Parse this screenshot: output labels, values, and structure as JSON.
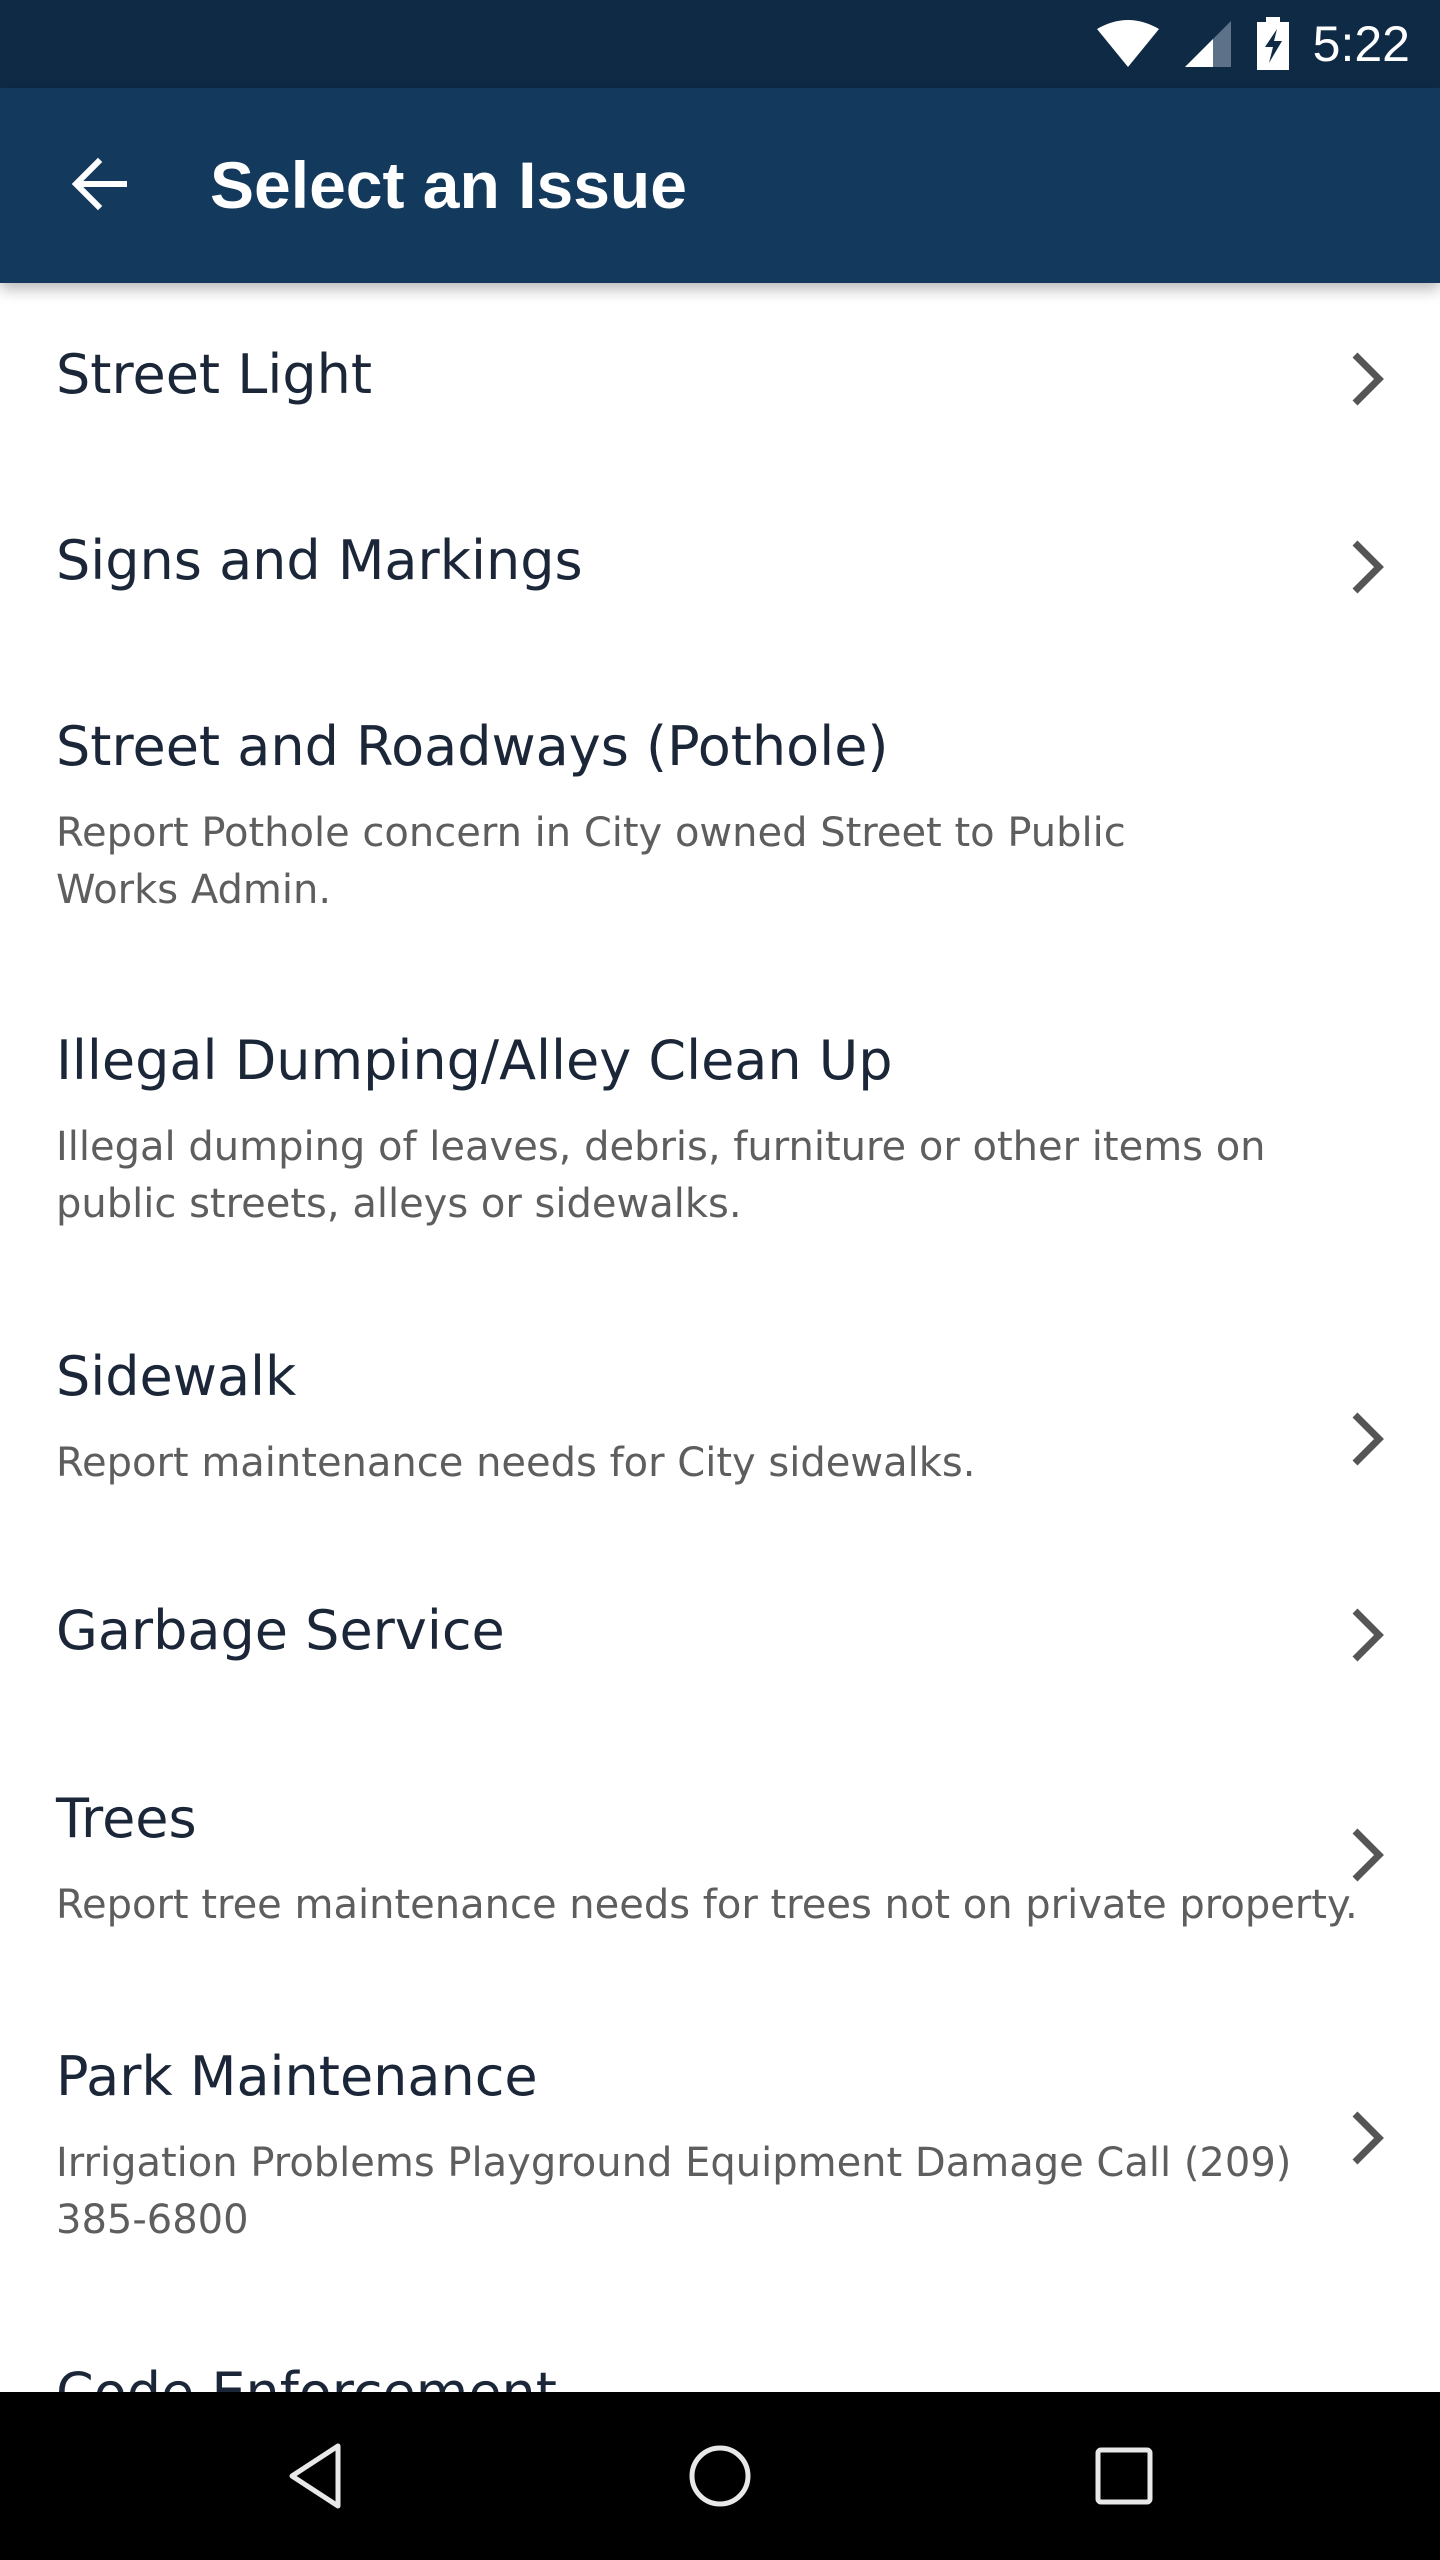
{
  "status_bar": {
    "time": "5:22",
    "icons": [
      "wifi-icon",
      "cell-signal-icon",
      "battery-charging-icon"
    ]
  },
  "app_bar": {
    "back_icon": "arrow-left-icon",
    "title": "Select an Issue"
  },
  "issues": [
    {
      "title": "Street Light",
      "description": "",
      "has_chevron": true
    },
    {
      "title": "Signs and Markings",
      "description": "",
      "has_chevron": true
    },
    {
      "title": "Street and Roadways (Pothole)",
      "description": "Report Pothole concern in City owned Street to Public Works Admin.",
      "has_chevron": false
    },
    {
      "title": "Illegal Dumping/Alley Clean Up",
      "description": "Illegal dumping of leaves, debris, furniture or other items on public streets, alleys or sidewalks.",
      "has_chevron": false
    },
    {
      "title": "Sidewalk",
      "description": "Report maintenance needs for City sidewalks.",
      "has_chevron": true
    },
    {
      "title": "Garbage Service",
      "description": "",
      "has_chevron": true
    },
    {
      "title": "Trees",
      "description": "Report tree maintenance needs for trees not on private property.",
      "has_chevron": true
    },
    {
      "title": "Park Maintenance",
      "description": "Irrigation Problems Playground Equipment Damage Call (209) 385-6800",
      "has_chevron": true
    },
    {
      "title": "Code Enforcement",
      "description": "",
      "has_chevron": false
    }
  ],
  "nav_bar": {
    "buttons": [
      "back-triangle-icon",
      "home-circle-icon",
      "recents-square-icon"
    ]
  },
  "colors": {
    "status_bar": "#0f2a45",
    "app_bar": "#133a5c",
    "title_text": "#1b2738",
    "description_text": "#5e5e5e",
    "chevron": "#555555"
  }
}
